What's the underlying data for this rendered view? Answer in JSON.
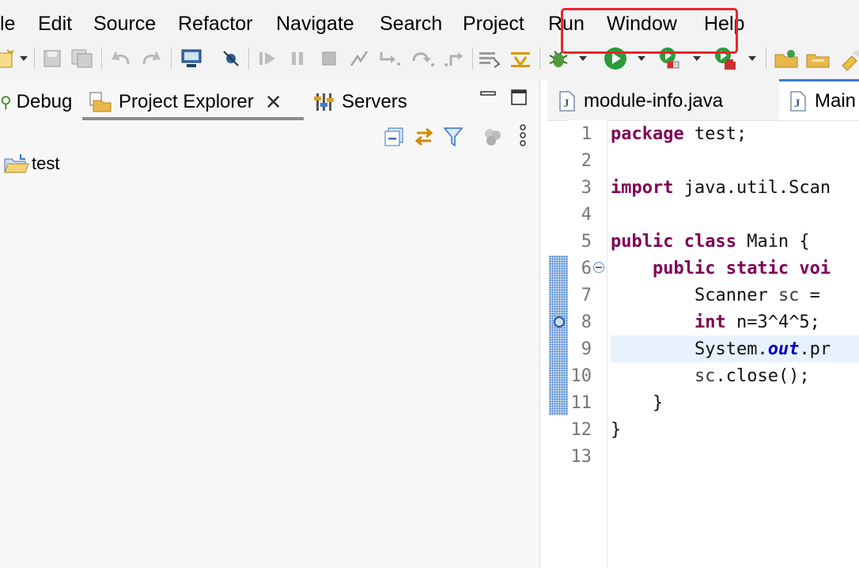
{
  "menu": {
    "file_partial": "le",
    "edit": "Edit",
    "source": "Source",
    "refactor": "Refactor",
    "navigate": "Navigate",
    "search": "Search",
    "project": "Project",
    "run": "Run",
    "window": "Window",
    "help": "Help"
  },
  "highlight_color": "#e8262b",
  "toolbar_icons": [
    "new-wizard-icon",
    "save-icon",
    "save-all-icon",
    "undo-icon",
    "redo-icon",
    "terminal-icon",
    "skip-breakpoints-icon",
    "resume-icon",
    "suspend-icon",
    "terminate-icon",
    "disconnect-icon",
    "step-into-icon",
    "step-over-icon",
    "step-return-icon",
    "drop-to-frame-icon",
    "use-step-filters-icon",
    "debug-icon",
    "run-icon",
    "coverage-icon",
    "external-tools-icon",
    "open-folder-icon",
    "open-type-icon",
    "search-flashlight-icon"
  ],
  "left_tabs": {
    "debug": "Debug",
    "project_explorer": "Project Explorer",
    "servers": "Servers"
  },
  "tree": {
    "project": "test"
  },
  "editor_tabs": {
    "module_info": "module-info.java",
    "main_partial": "Main"
  },
  "code": {
    "line_numbers": [
      "1",
      "2",
      "3",
      "4",
      "5",
      "6",
      "7",
      "8",
      "9",
      "10",
      "11",
      "12",
      "13"
    ],
    "l1_kw": "package",
    "l1_rest": " test;",
    "l3_kw": "import",
    "l3_rest": " java.util.Scan",
    "l5_kw": "public class",
    "l5_rest": " Main {",
    "l6_indent": "    ",
    "l6_kw": "public static voi",
    "l7_indent": "        ",
    "l7_type": "Scanner ",
    "l7_var": "sc",
    "l7_rest": " =",
    "l8_indent": "        ",
    "l8_kw": "int",
    "l8_rest": " n=3^4^5;",
    "l9_indent": "        ",
    "l9_a": "System.",
    "l9_field": "out",
    "l9_b": ".pr",
    "l10_indent": "        ",
    "l10_var": "sc",
    "l10_rest": ".close();",
    "l11": "    }",
    "l12": "}"
  }
}
